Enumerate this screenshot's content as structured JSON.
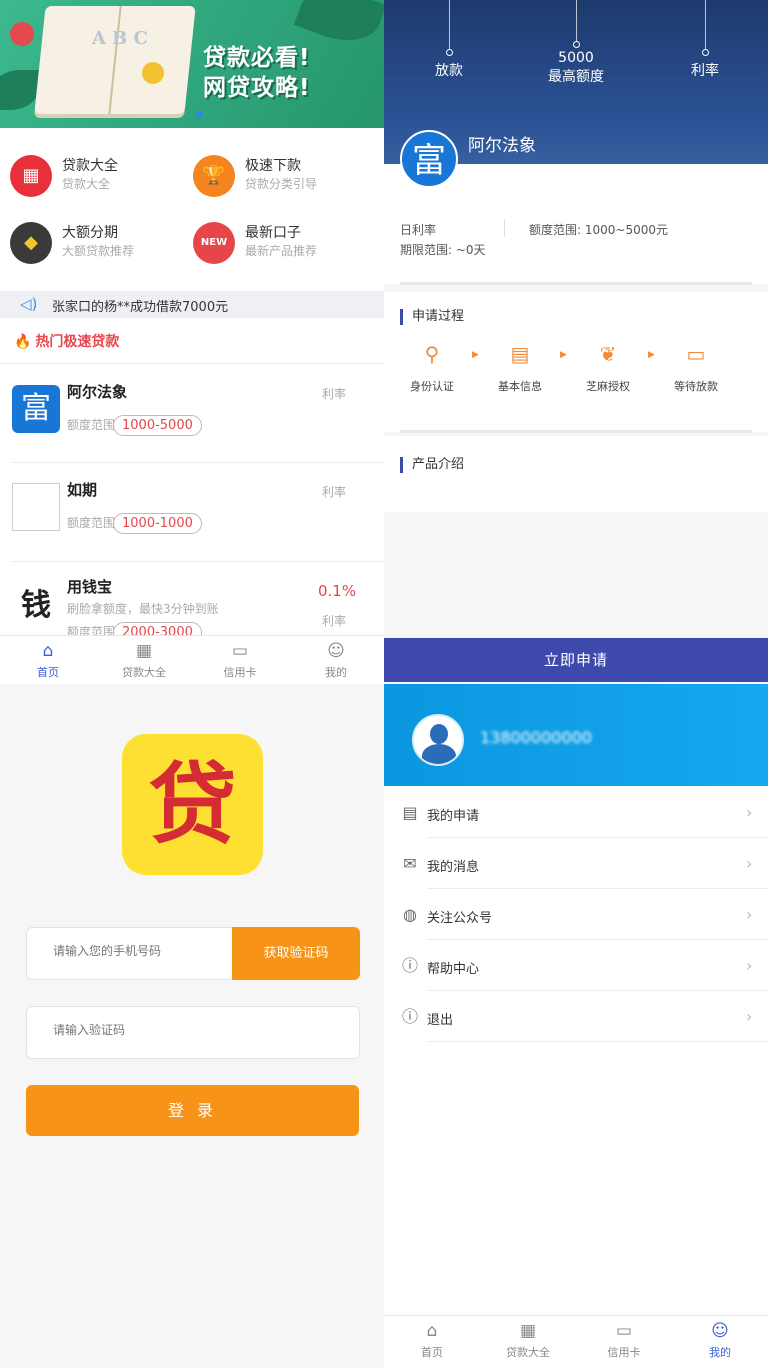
{
  "home": {
    "banner": {
      "line1": "贷款必看!",
      "line2": "网贷攻略!",
      "book_text": "ABC"
    },
    "categories": [
      {
        "title": "贷款大全",
        "sub": "贷款大全",
        "icon": "grid-icon",
        "color": "#e8303a"
      },
      {
        "title": "极速下款",
        "sub": "贷款分类引导",
        "icon": "trophy-icon",
        "color": "#f5841f"
      },
      {
        "title": "大额分期",
        "sub": "大额贷款推荐",
        "icon": "diamond-icon",
        "color": "#3a3a3a"
      },
      {
        "title": "最新口子",
        "sub": "最新产品推荐",
        "icon": "new-badge-icon",
        "color": "#e8454b"
      }
    ],
    "notice": "张家口的杨**成功借款7000元",
    "hot_title": "热门极速贷款",
    "products": [
      {
        "name": "阿尔法象",
        "range_label": "额度范围",
        "range": "1000-5000",
        "rate_label": "利率",
        "rate": ""
      },
      {
        "name": "如期",
        "range_label": "额度范围",
        "range": "1000-1000",
        "rate_label": "利率",
        "rate": ""
      },
      {
        "name": "用钱宝",
        "sub": "刷脸拿额度，最快3分钟到账",
        "range_label": "额度范围",
        "range": "2000-3000",
        "rate_label": "利率",
        "rate": "0.1%"
      }
    ]
  },
  "tabbar": {
    "home": "首页",
    "loans": "贷款大全",
    "card": "信用卡",
    "mine": "我的"
  },
  "detail": {
    "stats": {
      "left": "放款",
      "max_value": "5000",
      "max_label": "最高额度",
      "right": "利率"
    },
    "name": "阿尔法象",
    "logo_char": "富",
    "day_rate_label": "日利率",
    "amount_range": "额度范围: 1000~5000元",
    "term_range": "期限范围: ~0天",
    "process_title": "申请过程",
    "steps": [
      "身份认证",
      "基本信息",
      "芝麻授权",
      "等待放款"
    ],
    "intro_title": "产品介绍",
    "apply_button": "立即申请"
  },
  "login": {
    "logo_char": "贷",
    "phone_placeholder": "请输入您的手机号码",
    "get_code": "获取验证码",
    "code_placeholder": "请输入验证码",
    "login_button": "登 录"
  },
  "profile": {
    "phone": "13800000000",
    "menu": [
      {
        "label": "我的申请",
        "icon": "document-icon"
      },
      {
        "label": "我的消息",
        "icon": "mail-icon"
      },
      {
        "label": "关注公众号",
        "icon": "wechat-icon"
      },
      {
        "label": "帮助中心",
        "icon": "help-icon"
      },
      {
        "label": "退出",
        "icon": "info-icon"
      }
    ]
  },
  "colors": {
    "accent_blue": "#3d4aac",
    "accent_orange": "#f79418",
    "sky": "#0a97df",
    "rate_red": "#e5484d"
  }
}
